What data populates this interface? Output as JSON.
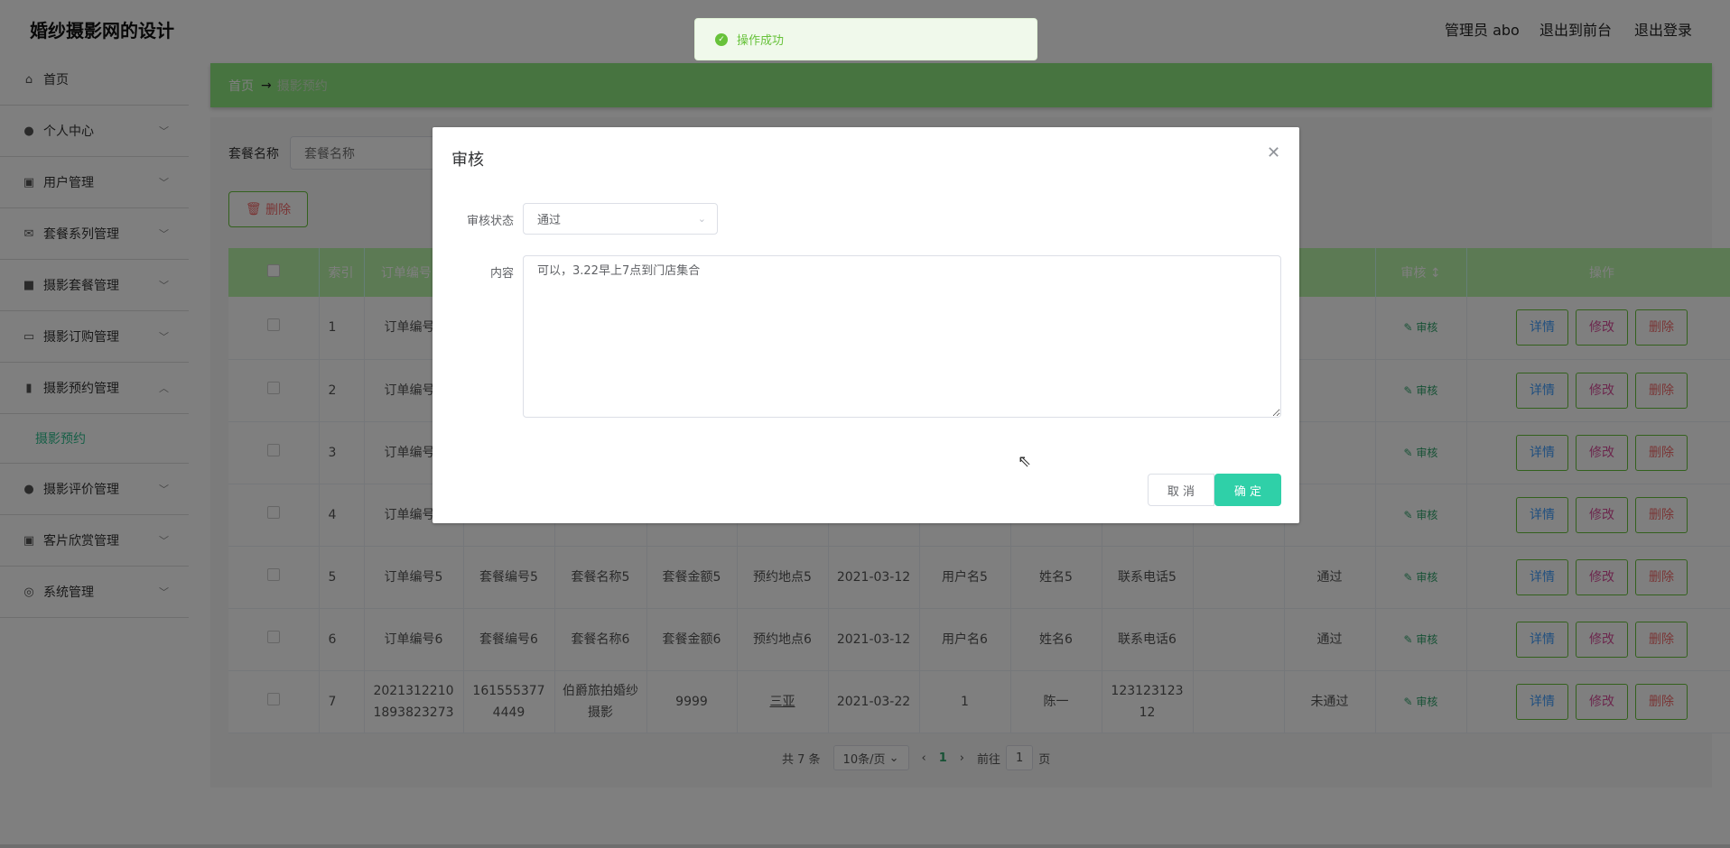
{
  "app_title": "婚纱摄影网的设计",
  "header": {
    "user": "管理员 abo",
    "front": "退出到前台",
    "logout": "退出登录"
  },
  "sidebar": {
    "items": [
      {
        "label": "首页",
        "icon": "home-icon"
      },
      {
        "label": "个人中心",
        "icon": "user-icon"
      },
      {
        "label": "用户管理",
        "icon": "clipboard-icon"
      },
      {
        "label": "套餐系列管理",
        "icon": "mail-icon"
      },
      {
        "label": "摄影套餐管理",
        "icon": "briefcase-icon"
      },
      {
        "label": "摄影订购管理",
        "icon": "chat-icon"
      },
      {
        "label": "摄影预约管理",
        "icon": "mic-icon"
      },
      {
        "label": "摄影评价管理",
        "icon": "user-icon"
      },
      {
        "label": "客片欣赏管理",
        "icon": "clipboard-icon"
      },
      {
        "label": "系统管理",
        "icon": "compass-icon"
      }
    ],
    "sub": "摄影预约"
  },
  "breadcrumb": {
    "home": "首页",
    "arrow": "→",
    "current": "摄影预约"
  },
  "search": {
    "label": "套餐名称",
    "placeholder": "套餐名称"
  },
  "delete_label": "删除",
  "table": {
    "headers": {
      "index": "索引",
      "order": "订单编号",
      "audit": "审核",
      "ops": "操作"
    },
    "rows": [
      {
        "i": "1",
        "order": "订单编号1",
        "pkg": "",
        "name": "",
        "amt": "",
        "place": "",
        "date": "",
        "user": "",
        "real": "",
        "phone": "",
        "reply": "",
        "status": ""
      },
      {
        "i": "2",
        "order": "订单编号2",
        "pkg": "",
        "name": "",
        "amt": "",
        "place": "",
        "date": "",
        "user": "",
        "real": "",
        "phone": "",
        "reply": "",
        "status": ""
      },
      {
        "i": "3",
        "order": "订单编号3",
        "pkg": "",
        "name": "",
        "amt": "",
        "place": "",
        "date": "",
        "user": "",
        "real": "",
        "phone": "",
        "reply": "",
        "status": ""
      },
      {
        "i": "4",
        "order": "订单编号4",
        "pkg": "",
        "name": "",
        "amt": "",
        "place": "",
        "date": "",
        "user": "",
        "real": "",
        "phone": "",
        "reply": "",
        "status": ""
      },
      {
        "i": "5",
        "order": "订单编号5",
        "pkg": "套餐编号5",
        "name": "套餐名称5",
        "amt": "套餐金额5",
        "place": "预约地点5",
        "date": "2021-03-12",
        "user": "用户名5",
        "real": "姓名5",
        "phone": "联系电话5",
        "reply": "",
        "status": "通过"
      },
      {
        "i": "6",
        "order": "订单编号6",
        "pkg": "套餐编号6",
        "name": "套餐名称6",
        "amt": "套餐金额6",
        "place": "预约地点6",
        "date": "2021-03-12",
        "user": "用户名6",
        "real": "姓名6",
        "phone": "联系电话6",
        "reply": "",
        "status": "通过"
      },
      {
        "i": "7",
        "order": "20213122101893823273",
        "pkg": "1615553774449",
        "name": "伯爵旅拍婚纱摄影",
        "amt": "9999",
        "place": "三亚",
        "date": "2021-03-22",
        "user": "1",
        "real": "陈一",
        "phone": "12312312312",
        "reply": "",
        "status": "未通过"
      }
    ],
    "audit_link": "审核",
    "btn_detail": "详情",
    "btn_edit": "修改",
    "btn_delete": "删除"
  },
  "pager": {
    "total": "共 7 条",
    "size": "10条/页",
    "page": "1",
    "goto": "前往",
    "goto_val": "1",
    "unit": "页"
  },
  "modal": {
    "title": "审核",
    "status_label": "审核状态",
    "status_value": "通过",
    "content_label": "内容",
    "content_value": "可以，3.22早上7点到门店集合",
    "cancel": "取 消",
    "ok": "确 定"
  },
  "toast": "操作成功"
}
